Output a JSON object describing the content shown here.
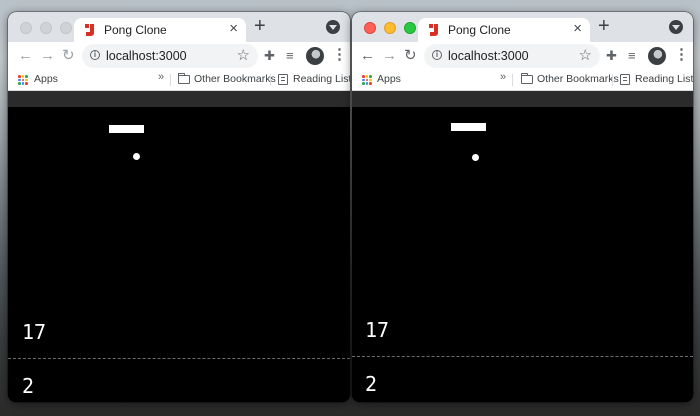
{
  "windows": {
    "left": {
      "tab": {
        "title": "Pong Clone"
      },
      "address": {
        "url": "localhost:3000"
      },
      "bookmarks": {
        "apps": "Apps",
        "overflow": "»",
        "other": "Other Bookmarks",
        "reading": "Reading List"
      },
      "game": {
        "score_top": "17",
        "score_bottom": "2"
      }
    },
    "right": {
      "tab": {
        "title": "Pong Clone"
      },
      "address": {
        "url": "localhost:3000"
      },
      "bookmarks": {
        "apps": "Apps",
        "overflow": "»",
        "other": "Other Bookmarks",
        "reading": "Reading List"
      },
      "game": {
        "score_top": "17",
        "score_bottom": "2"
      }
    }
  },
  "icons": {
    "tab_close": "close-icon",
    "new_tab": "plus-icon",
    "back": "arrow-left-icon",
    "forward": "arrow-right-icon",
    "reload": "reload-icon",
    "site_info": "info-icon",
    "bookmark_star": "star-icon",
    "extensions": "puzzle-icon",
    "reading_queue": "media-queue-icon",
    "profile": "avatar",
    "menu": "kebab-icon"
  },
  "colors": {
    "favicon_red": "#d93025",
    "chrome_frame": "#dee1e6",
    "game_background": "#000000",
    "game_foreground": "#ffffff"
  }
}
